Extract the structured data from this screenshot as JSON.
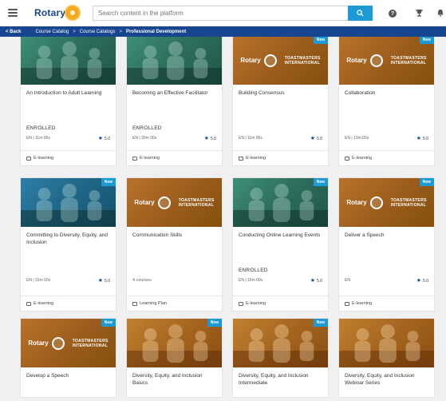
{
  "header": {
    "brand": "Rotary",
    "search_placeholder": "Search content in the platform",
    "help_label": "?",
    "icons": [
      "menu-icon",
      "search-icon",
      "help-icon",
      "trophy-icon",
      "bell-icon"
    ]
  },
  "breadcrumb": {
    "back": "< Back",
    "items": [
      "Course Catalog",
      "Course Catalogs",
      "Professional Development"
    ],
    "separator": ">"
  },
  "brand_colors": {
    "rotary_blue": "#17458f",
    "accent": "#1b9ad6",
    "gold": "#f7a81b"
  },
  "cards": [
    {
      "title": "An Introduction to Adult Learning",
      "enrolled": "ENROLLED",
      "meta": "EN  |  11m 00s",
      "rating": "5.0",
      "type": "E-learning",
      "image": "green",
      "new": ""
    },
    {
      "title": "Becoming an Effective Facilitator",
      "enrolled": "ENROLLED",
      "meta": "EN  |  30m 00s",
      "rating": "5.0",
      "type": "E-learning",
      "image": "green",
      "new": ""
    },
    {
      "title": "Building Consensus",
      "enrolled": "",
      "meta": "EN  |  11m 00s",
      "rating": "5.0",
      "type": "E-learning",
      "image": "orange",
      "new": "New"
    },
    {
      "title": "Collaboration",
      "enrolled": "",
      "meta": "EN  |  13m 00s",
      "rating": "5.0",
      "type": "E-learning",
      "image": "orange",
      "new": "New"
    },
    {
      "title": "Committing to Diversity, Equity, and Inclusion",
      "enrolled": "",
      "meta": "EN  |  15m 00s",
      "rating": "5.0",
      "type": "E-learning",
      "image": "blue",
      "new": "New"
    },
    {
      "title": "Communication Skills",
      "enrolled": "",
      "count": "4 courses",
      "meta": "",
      "rating": "",
      "type": "Learning Plan",
      "image": "orange",
      "new": ""
    },
    {
      "title": "Conducting Online Learning Events",
      "enrolled": "ENROLLED",
      "meta": "EN  |  15m 00s",
      "rating": "5.0",
      "type": "E-learning",
      "image": "green",
      "new": "New"
    },
    {
      "title": "Deliver a Speech",
      "enrolled": "",
      "meta": "EN",
      "rating": "5.0",
      "type": "E-learning",
      "image": "orange",
      "new": "New"
    },
    {
      "title": "Develop a Speech",
      "image": "orange",
      "new": "New"
    },
    {
      "title": "Diversity, Equity, and Inclusion Basics",
      "image": "photo-orange",
      "new": "New"
    },
    {
      "title": "Diversity, Equity, and Inclusion Intermediate",
      "image": "photo-orange",
      "new": "New"
    },
    {
      "title": "Diversity, Equity, and Inclusion Webinar Series",
      "image": "photo-orange",
      "new": ""
    }
  ],
  "brand_block": {
    "rotary": "Rotary",
    "toastmasters_line1": "TOASTMASTERS",
    "toastmasters_line2": "INTERNATIONAL"
  }
}
